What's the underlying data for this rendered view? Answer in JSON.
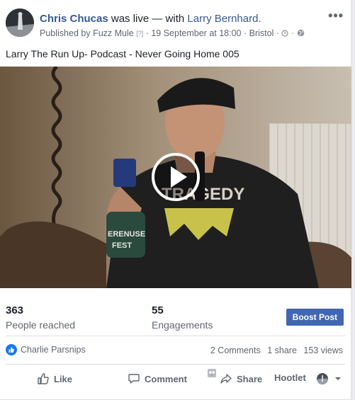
{
  "post": {
    "author": "Chris Chucas",
    "live_phrase": " was live — with ",
    "tagged": "Larry Bernhard.",
    "published_prefix": "Published by ",
    "publisher": "Fuzz Mule",
    "help_mark": "[?]",
    "date": " · 19 September at 18:00 · Bristol ·",
    "text": "Larry The Run Up- Podcast - Never Going Home 005"
  },
  "stats": {
    "reached_value": "363",
    "reached_label": "People reached",
    "engagements_value": "55",
    "engagements_label": "Engagements",
    "boost_label": "Boost Post"
  },
  "social": {
    "reactor": "Charlie Parsnips",
    "comments": "2 Comments",
    "shares": "1 share",
    "views": "153 views"
  },
  "actions": {
    "like": "Like",
    "comment": "Comment",
    "share": "Share",
    "hootlet": "Hootlet"
  },
  "colors": {
    "link": "#365899",
    "boost": "#4267b2",
    "like_blue": "#1877f2"
  },
  "icons": [
    "more-options-icon",
    "clock-icon",
    "globe-icon",
    "play-icon",
    "like-reaction-icon",
    "thumbs-up-icon",
    "comment-icon",
    "hootlet-owl-icon",
    "share-icon",
    "profile-menu-icon",
    "chevron-down-icon"
  ]
}
